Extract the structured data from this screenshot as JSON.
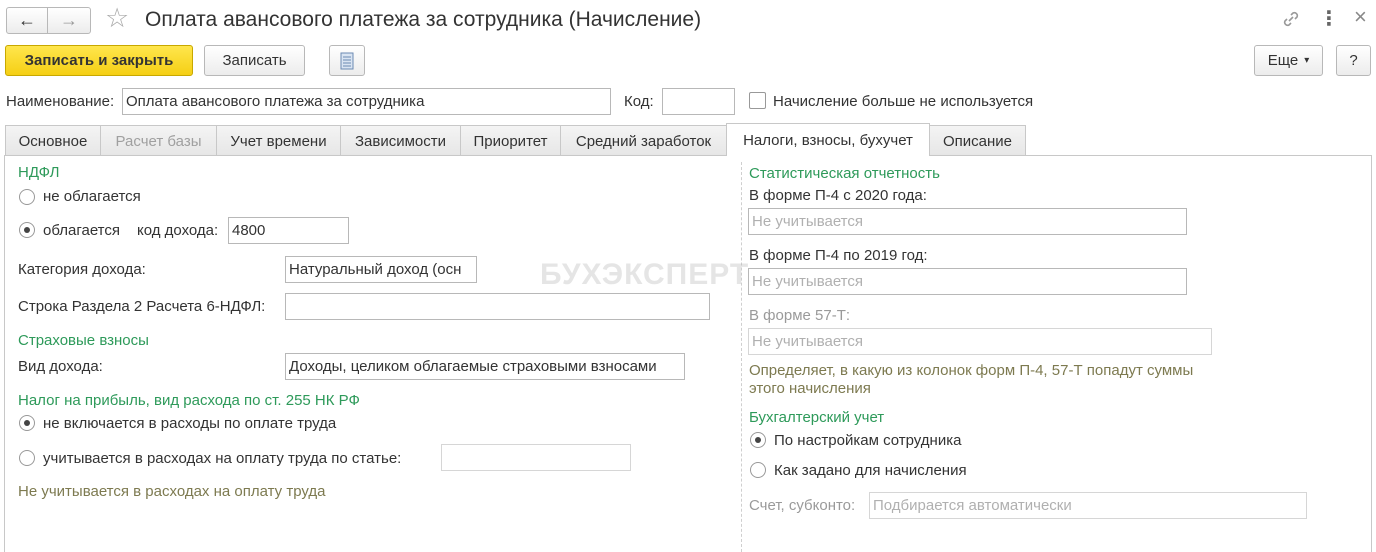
{
  "window": {
    "title": "Оплата авансового платежа за сотрудника (Начисление)",
    "nav_back": "←",
    "nav_forward": "→",
    "star": "☆",
    "link_glyph": "🔗",
    "more_glyph": "⋮",
    "close_glyph": "×"
  },
  "toolbar": {
    "save_close": "Записать и закрыть",
    "save": "Записать",
    "more": "Еще",
    "more_arrow": "▾",
    "help": "?"
  },
  "header": {
    "name_label": "Наименование:",
    "name_value": "Оплата авансового платежа за сотрудника",
    "code_label": "Код:",
    "code_value": "",
    "unused_label": "Начисление больше не используется"
  },
  "tabs": [
    {
      "label": "Основное"
    },
    {
      "label": "Расчет базы"
    },
    {
      "label": "Учет времени"
    },
    {
      "label": "Зависимости"
    },
    {
      "label": "Приоритет"
    },
    {
      "label": "Средний заработок"
    },
    {
      "label": "Налоги, взносы, бухучет"
    },
    {
      "label": "Описание"
    }
  ],
  "left": {
    "ndfl_title": "НДФЛ",
    "ndfl_not_taxed": "не облагается",
    "ndfl_taxed": "облагается",
    "income_code_label": "код дохода:",
    "income_code_value": "4800",
    "income_category_label": "Категория дохода:",
    "income_category_value": "Натуральный доход (осн",
    "row_6ndfl_label": "Строка Раздела 2 Расчета 6-НДФЛ:",
    "row_6ndfl_value": "",
    "insurance_title": "Страховые взносы",
    "income_type_label": "Вид дохода:",
    "income_type_value": "Доходы, целиком облагаемые страховыми взносами",
    "profit_tax_title": "Налог на прибыль, вид расхода по ст. 255 НК РФ",
    "profit_not_included": "не включается в расходы по оплате труда",
    "profit_included": "учитывается в расходах на оплату труда по статье:",
    "profit_article_value": "",
    "profit_hint": "Не учитывается в расходах на оплату труда"
  },
  "right": {
    "stat_title": "Статистическая отчетность",
    "p4_2020_label": "В форме П-4 с 2020 года:",
    "p4_2020_placeholder": "Не учитывается",
    "p4_2019_label": "В форме П-4 по 2019 год:",
    "p4_2019_placeholder": "Не учитывается",
    "f57t_label": "В форме 57-Т:",
    "f57t_placeholder": "Не учитывается",
    "stat_hint": "Определяет, в какую из колонок форм П-4, 57-Т попадут суммы этого начисления",
    "acc_title": "Бухгалтерский учет",
    "acc_by_employee": "По настройкам сотрудника",
    "acc_as_set": "Как задано для начисления",
    "account_label": "Счет, субконто:",
    "account_placeholder": "Подбирается автоматически"
  },
  "watermark": "БУХЭКСПЕРТ",
  "colors": {
    "primary_button": "#f5cf14",
    "section_title": "#2e9a5a",
    "hint_text": "#7d7a50"
  }
}
